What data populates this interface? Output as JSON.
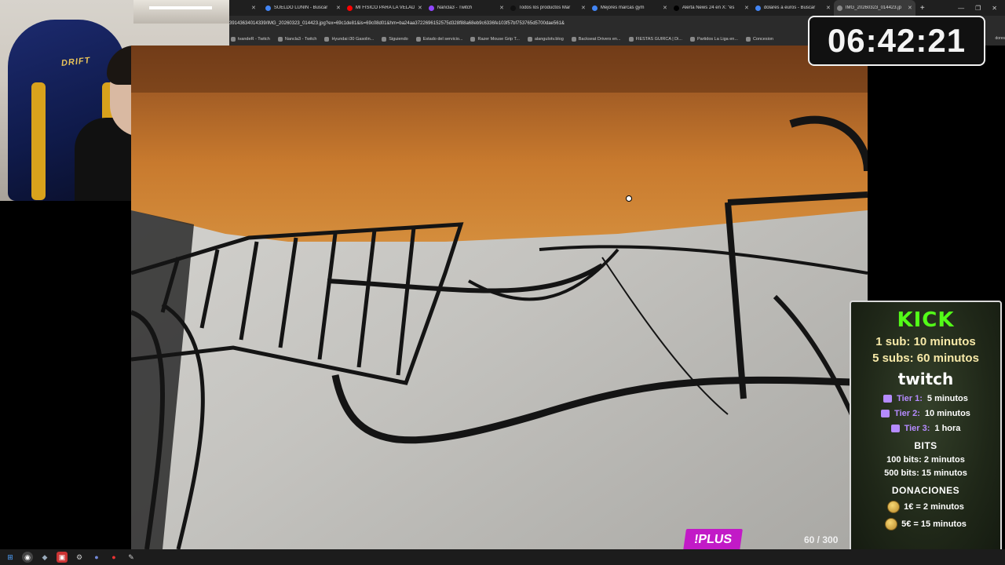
{
  "browser": {
    "tabs": [
      {
        "title": "SUELDO LUNIN - Buscar",
        "color": "#4285f4"
      },
      {
        "title": "MI FISICO PARA LA VELADA",
        "color": "#ff0000"
      },
      {
        "title": "Nancla3 - Twitch",
        "color": "#9146ff"
      },
      {
        "title": "Todos los productos Mar",
        "color": "#111111"
      },
      {
        "title": "Mejores marcas gym",
        "color": "#4285f4"
      },
      {
        "title": "Alerta News 24 en X: \"es",
        "color": "#000000"
      },
      {
        "title": "dolares a euros - Buscar",
        "color": "#4285f4"
      },
      {
        "title": "IMG_20260323_014423.jp",
        "color": "#888888"
      }
    ],
    "url": "39143634014339/IMG_20260323_014423.jpg?ex=69c1de81&is=69c08d01&hm=ba24aa3722696152575d328f88a68eb9c6336fe103f57bf753765d5700dae561&",
    "bookmarks": [
      "tvandeR - Twitch",
      "Nancla3 - Twitch",
      "Hyundai i30 Gasolin...",
      "Siguiendo",
      "Estado del servicio...",
      "Razer Mouse Grip T...",
      "alanguIotv.blog",
      "Backseat Drivers en...",
      "FIESTAS GUIRCA | Di...",
      "Partidos La Liga en...",
      "Concesion"
    ],
    "bookmarks_overflow": "dores"
  },
  "webcam": {
    "chair_brand": "DRIFT"
  },
  "timer": "06:42:21",
  "panel": {
    "kick": "KICK",
    "kick_lines": [
      {
        "label": "1 sub:",
        "value": "10 minutos"
      },
      {
        "label": "5 subs:",
        "value": "60 minutos"
      }
    ],
    "twitch": "twitch",
    "tiers": [
      {
        "label": "Tier 1:",
        "value": "5 minutos"
      },
      {
        "label": "Tier 2:",
        "value": "10 minutos"
      },
      {
        "label": "Tier 3:",
        "value": "1 hora"
      }
    ],
    "bits_title": "BITS",
    "bits": [
      "100 bits: 2 minutos",
      "500 bits: 15 minutos"
    ],
    "donations_title": "DONACIONES",
    "donations": [
      "1€ = 2 minutos",
      "5€ = 15 minutos"
    ]
  },
  "overlay": {
    "plus": "!PLUS",
    "counter": "60 / 300"
  }
}
